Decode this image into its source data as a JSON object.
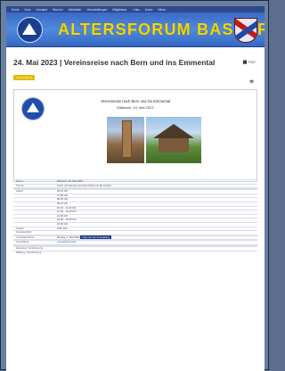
{
  "nav": {
    "items": [
      "Home",
      "Infos",
      "Vorstand",
      "Was tun",
      "Aktivitäten",
      "Veranstaltungen",
      "Mitgliedsch.",
      "Links",
      "Archiv",
      "Klima"
    ]
  },
  "banner": {
    "title": "ALTERSFORUM BASSERSDORF",
    "title_color": "#f2d60a",
    "banner_color": "#3a6ac6",
    "logo_icon": "alpine-triangle-logo",
    "crest_icon": "municipal-crest"
  },
  "article": {
    "heading": "24. Mai 2023 | Vereinsreise nach Bern und ins Emmental",
    "pdf_label": "PDF",
    "print_icon": "print-icon",
    "tag": "Veranstaltung",
    "card_title": "Vereinsreise nach Bern und ins Emmental",
    "card_date": "Mittwoch, 24. Mai 2023"
  },
  "details": {
    "rows": [
      {
        "k": "Datum",
        "v": "Mittwoch, 24. Mai 2023"
      },
      {
        "k": "Thema",
        "v": "Kunst und Genuss auf einer Reise ins Emmental"
      },
      {
        "k": "",
        "v": ""
      },
      {
        "k": "",
        "v": ""
      },
      {
        "k": "Ablauf",
        "v": "06.45 Uhr"
      },
      {
        "k": "",
        "v": "07.00 Uhr"
      },
      {
        "k": "",
        "v": "09.00 Uhr"
      },
      {
        "k": "",
        "v": "09.15 Uhr"
      },
      {
        "k": "",
        "v": "10.15 - 11.30 Uhr"
      },
      {
        "k": "",
        "v": "12.00 - 14.00 Uhr"
      },
      {
        "k": "",
        "v": "14.00 Uhr"
      },
      {
        "k": "",
        "v": "15.00 - 16.00 Uhr"
      },
      {
        "k": "",
        "v": "18.00 Uhr"
      },
      {
        "k": "Kosten",
        "v": "CHF 120.–"
      },
      {
        "k": "Verantwortlich",
        "v": ""
      },
      {
        "k": "",
        "v": ""
      },
      {
        "k": "Anmeldeschluss",
        "v": "Montag, 1. Mai 2023"
      },
      {
        "k": "",
        "v": ""
      },
      {
        "k": "Anmeldung",
        "v": ""
      },
      {
        "k": "",
        "v": ""
      },
      {
        "k": "",
        "v": ""
      },
      {
        "k": "Hinweise / Versicherung",
        "v": ""
      },
      {
        "k": "Haftung / Versicherung",
        "v": ""
      }
    ],
    "highlight": "Infos auf der Anmeldung",
    "register_link": "Anmeldeformular"
  }
}
